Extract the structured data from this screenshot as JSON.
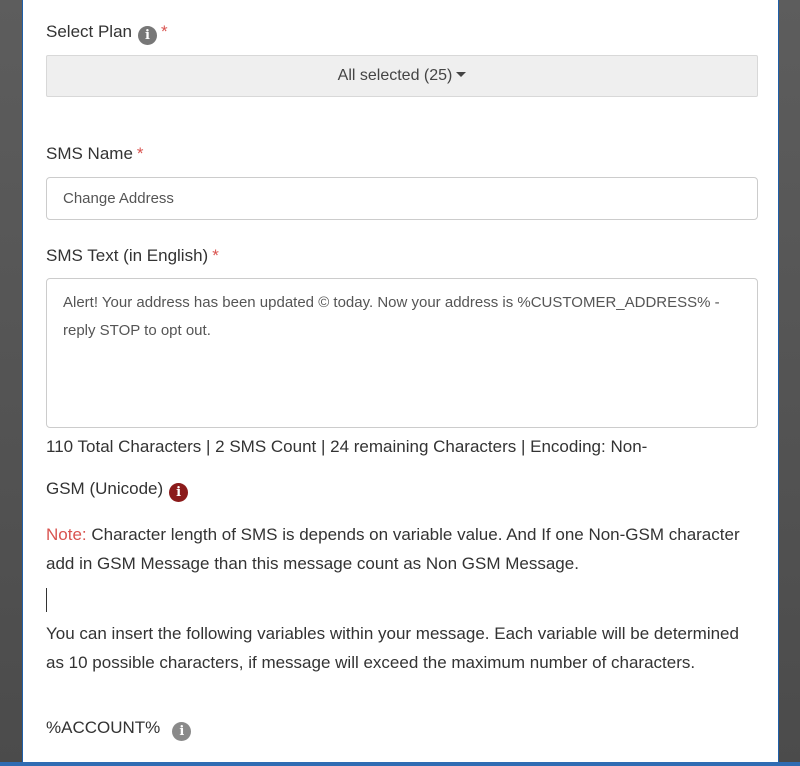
{
  "plan": {
    "label": "Select Plan",
    "required_mark": "*",
    "selected_text": "All selected (25)"
  },
  "sms_name": {
    "label": "SMS Name",
    "required_mark": "*",
    "value": "Change Address"
  },
  "sms_text": {
    "label": "SMS Text (in English)",
    "required_mark": "*",
    "value": "Alert! Your address has been updated © today. Now your address is %CUSTOMER_ADDRESS% - reply STOP to opt out."
  },
  "counter": {
    "line1": "110 Total Characters | 2 SMS Count | 24 remaining Characters | Encoding: Non-",
    "line2": "GSM (Unicode)"
  },
  "note": {
    "prefix": "Note:",
    "text": " Character length of SMS is depends on variable value. And If one Non-GSM character add in GSM Message than this message count as Non GSM Message."
  },
  "variables_help": "You can insert the following variables within your message. Each variable will be determined as 10 possible characters, if message will exceed the maximum number of characters.",
  "variables": [
    {
      "name": "%ACCOUNT%"
    }
  ],
  "colors": {
    "required": "#d9534f",
    "modal_border": "#1f5fa8"
  }
}
